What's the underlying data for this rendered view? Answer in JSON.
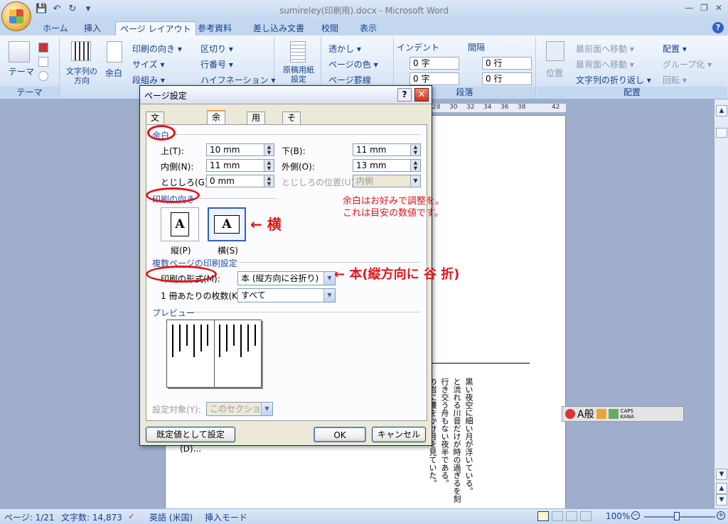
{
  "window": {
    "title": "sumireley(印刷用).docx - Microsoft Word",
    "controls": [
      "—",
      "❐",
      "✕"
    ]
  },
  "qat": {
    "save": "💾",
    "undo": "↶",
    "redo": "↻",
    "more": "▾"
  },
  "tabs": [
    "ホーム",
    "挿入",
    "ページ レイアウト",
    "参考資料",
    "差し込み文書",
    "校閲",
    "表示"
  ],
  "ribbon": {
    "theme": {
      "label": "テーマ",
      "btn": "テーマ"
    },
    "page_setup": {
      "text_dir": "文字列の方向",
      "margins": "余白",
      "orientation": "印刷の向き ▾",
      "size": "サイズ ▾",
      "columns": "段組み ▾",
      "breaks": "区切り ▾",
      "line_numbers": "行番号 ▾",
      "hyphenation": "ハイフネーション ▾",
      "genkou": "原稿用紙設定"
    },
    "background": {
      "watermark": "透かし ▾",
      "page_color": "ページの色 ▾",
      "page_borders": "ページ罫線"
    },
    "paragraph": {
      "indent_label": "インデント",
      "spacing_label": "間隔",
      "indent_left": "0 字",
      "indent_right": "0 字",
      "space_before": "0 行",
      "space_after": "0 行",
      "group": "段落"
    },
    "arrange": {
      "position": "位置",
      "bring_front": "最前面へ移動 ▾",
      "send_back": "最背面へ移動 ▾",
      "text_wrap": "文字列の折り返し ▾",
      "align": "配置 ▾",
      "group_obj": "グループ化 ▾",
      "rotate": "回転 ▾",
      "group": "配置"
    }
  },
  "ruler": [
    "28",
    "30",
    "32",
    "34",
    "36",
    "38",
    "42"
  ],
  "document_text": [
    "黒い夜空に細い月が浮いている。",
    "と流れる川音だけが時の過ぎるを刻",
    "行き交う舟もない夜半である。",
    "の岩に腰をかけ月を見ていた。",
    "の声だけがささや",
    "はかり気も緩み、",
    "だ。人ならぬもの",
    "だ。メイコがこ",
    "る。平生は川底に",
    "涼が月光を珠と",
    "くなると、音の",
    "音に驚き振り返",
    "姿があった。",
    "きローレライ。",
    "イコは人ならぬ",
    "しかまた。水底に",
    "かった。",
    "面影を湛えてい"
  ],
  "ime": {
    "mode": "A般",
    "caps": "CAPS",
    "kana": "KANA"
  },
  "status": {
    "page": "ページ: 1/21",
    "words": "文字数: 14,873",
    "lang": "英語 (米国)",
    "insert": "挿入モード",
    "zoom": "100%"
  },
  "dialog": {
    "title": "ページ設定",
    "help": "?",
    "close": "✕",
    "tabs": [
      "文字数と行数",
      "余白",
      "用紙",
      "その他"
    ],
    "margins_section": "余白",
    "top_label": "上(T):",
    "top_value": "10 mm",
    "bottom_label": "下(B):",
    "bottom_value": "11 mm",
    "inside_label": "内側(N):",
    "inside_value": "11 mm",
    "outside_label": "外側(O):",
    "outside_value": "13 mm",
    "gutter_label": "とじしろ(G):",
    "gutter_value": "0 mm",
    "gutter_pos_label": "とじしろの位置(U):",
    "gutter_pos_value": "内側",
    "orientation_section": "印刷の向き",
    "portrait_label": "縦(P)",
    "landscape_label": "横(S)",
    "paper_letter": "A",
    "multi_section": "複数ページの印刷設定",
    "format_label": "印刷の形式(M):",
    "format_value": "本 (縦方向に谷折り)",
    "sheets_label": "1 冊あたりの枚数(K):",
    "sheets_value": "すべて",
    "preview_section": "プレビュー",
    "apply_label": "設定対象(Y):",
    "apply_value": "このセクション",
    "default_btn": "既定値として設定(D)...",
    "ok_btn": "OK",
    "cancel_btn": "キャンセル"
  },
  "annotations": {
    "note1": "余白はお好みで調整を。",
    "note2": "これは目安の数値です。",
    "arrow1": "←  横",
    "arrow2": "← 本(縦方向に 谷 折)"
  },
  "colors": {
    "annotation": "#e3141a",
    "ribbon_text": "#15428b"
  }
}
